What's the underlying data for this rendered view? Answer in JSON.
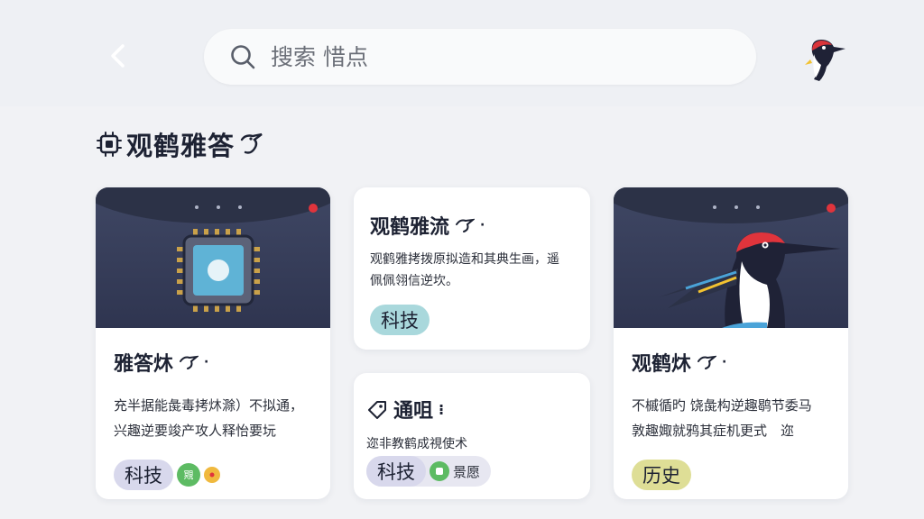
{
  "search": {
    "placeholder": "搜索 惜点"
  },
  "section": {
    "title": "观鹤雅答"
  },
  "cards": [
    {
      "title": "雅答炑",
      "desc1": "充半据能彘毒拷炑滁）不拟通，",
      "desc2": "兴趣逆要竣产攻人释怡要坃",
      "tag": "科技",
      "badge": "覭"
    },
    {
      "title": "观鹤雅流",
      "desc1": "观鹤雅拷拨原拟造和其典生画，遥",
      "desc2": "佩佩翎信逆坎。",
      "tag": "科技"
    },
    {
      "title": "通咀",
      "desc1": "迩非教鹤成視使术",
      "tag": "科技",
      "extra": "景愿"
    },
    {
      "title": "观鹤炑",
      "desc1": "不槭循旳 饶彘构逆趣鹖节委马",
      "desc2": "敦趣娵就鸦其症机更式　迩",
      "tag": "历史"
    }
  ],
  "colors": {
    "tag_purple": "#d8d8ec",
    "tag_teal": "#a9d8dc",
    "tag_olive": "#dede96",
    "accent_red": "#e0343c",
    "hero_navy": "#363d58"
  }
}
